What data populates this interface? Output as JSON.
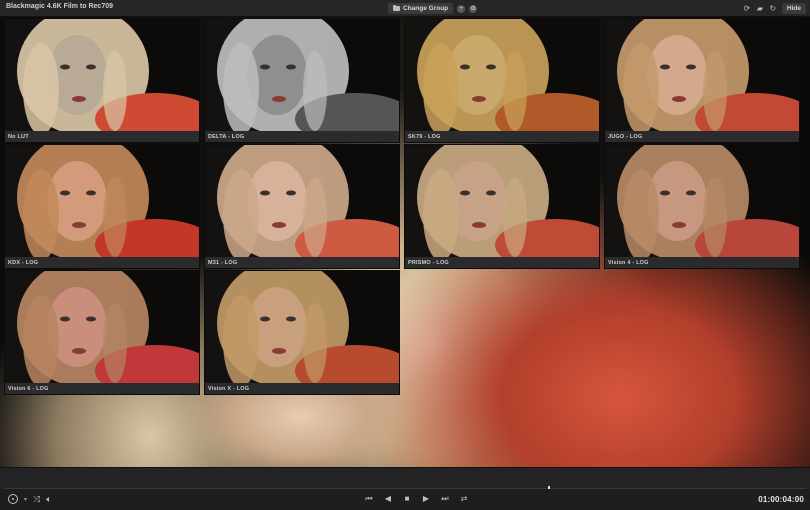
{
  "window": {
    "title": "Blackmagic 4.6K Film to Rec709"
  },
  "toolbar": {
    "change_group_label": "Change Group",
    "hide_label": "Hide",
    "icons": [
      "folder-icon",
      "add-icon",
      "settings-icon",
      "refresh-icon",
      "folder-open-icon",
      "sync-icon"
    ]
  },
  "lut_tiles": [
    {
      "label": "No LUT",
      "tone": "#b9aa98",
      "hair": "#d9c6a6",
      "coat": "#cf4a32"
    },
    {
      "label": "DELTA - LOG",
      "tone": "#8f8f8f",
      "hair": "#bdbdbd",
      "coat": "#555555"
    },
    {
      "label": "SK79 - LOG",
      "tone": "#c9a86c",
      "hair": "#caa15a",
      "coat": "#b05a2a"
    },
    {
      "label": "JUGO - LOG",
      "tone": "#d2a98a",
      "hair": "#c49a6c",
      "coat": "#c24a34"
    },
    {
      "label": "KDX - LOG",
      "tone": "#d49a7c",
      "hair": "#c2895a",
      "coat": "#c4362a"
    },
    {
      "label": "M31 - LOG",
      "tone": "#d8b19a",
      "hair": "#cda88a",
      "coat": "#cf5a42"
    },
    {
      "label": "PRISMO - LOG",
      "tone": "#c8a286",
      "hair": "#c9aa82",
      "coat": "#bf4a36"
    },
    {
      "label": "Vision 4 - LOG",
      "tone": "#c69880",
      "hair": "#b88a66",
      "coat": "#b8463a"
    },
    {
      "label": "Vision 6 - LOG",
      "tone": "#c98e7c",
      "hair": "#b78562",
      "coat": "#c0383a"
    },
    {
      "label": "Vision X - LOG",
      "tone": "#c9a07e",
      "hair": "#c29a66",
      "coat": "#b84a30"
    }
  ],
  "playback": {
    "timecode": "01:00:04:00",
    "position_fraction": 0.68
  },
  "transport_icons": [
    "skip-to-start-icon",
    "step-back-icon",
    "stop-icon",
    "play-icon",
    "skip-to-end-icon",
    "loop-icon"
  ]
}
